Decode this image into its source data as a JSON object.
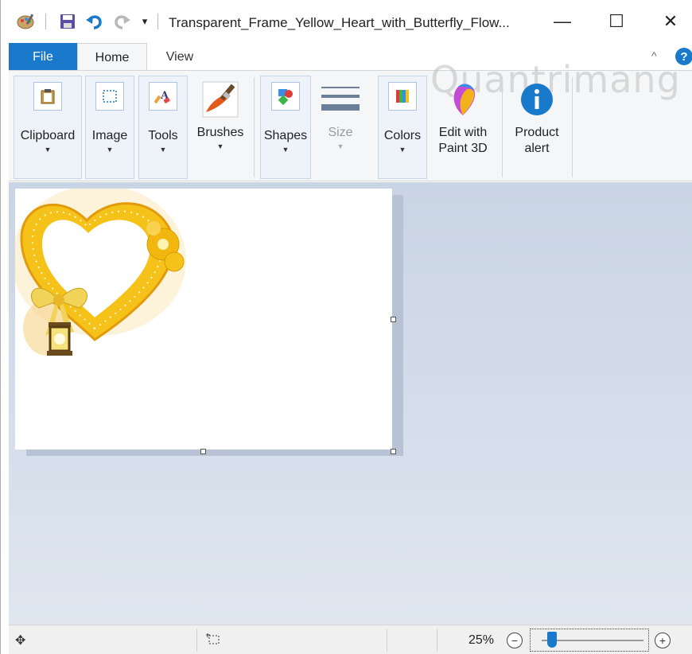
{
  "window": {
    "title": "Transparent_Frame_Yellow_Heart_with_Butterfly_Flow...",
    "quick_access": [
      "paint-app-icon",
      "save-icon",
      "undo-icon",
      "redo-icon",
      "customize-quick-access-icon"
    ],
    "controls": {
      "minimize": "—",
      "maximize": "☐",
      "close": "✕"
    }
  },
  "tabs": {
    "file": "File",
    "home": "Home",
    "view": "View",
    "collapse": "^",
    "help": "?"
  },
  "ribbon": {
    "clipboard": "Clipboard",
    "image": "Image",
    "tools": "Tools",
    "brushes": "Brushes",
    "shapes": "Shapes",
    "size": "Size",
    "colors": "Colors",
    "edit_paint3d_line1": "Edit with",
    "edit_paint3d_line2": "Paint 3D",
    "product_alert_line1": "Product",
    "product_alert_line2": "alert"
  },
  "watermark": "Quantrimang",
  "canvas": {
    "image": "yellow-heart-frame-with-bow-flowers-and-lantern"
  },
  "statusbar": {
    "zoom": "25%",
    "zoom_out": "−",
    "zoom_in": "+",
    "zoom_level_fraction": 0.1
  },
  "colors": {
    "accent": "#1979ca",
    "workspace": "#cdd7e6"
  }
}
